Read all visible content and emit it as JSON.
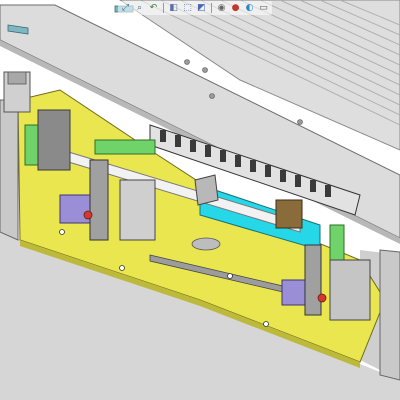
{
  "app": {
    "title": ""
  },
  "toolbar": {
    "buttons": [
      {
        "name": "zoom-to-fit-button",
        "icon": "zoom-fit-icon",
        "glyph": "⤢",
        "color": "#3a6ea5"
      },
      {
        "name": "zoom-to-area-button",
        "icon": "zoom-area-icon",
        "glyph": "⌕",
        "color": "#3a6ea5"
      },
      {
        "name": "previous-view-button",
        "icon": "previous-view-icon",
        "glyph": "↶",
        "color": "#2f7d3a"
      },
      {
        "name": "section-view-button",
        "icon": "section-view-icon",
        "glyph": "◧",
        "color": "#5b6fa8"
      },
      {
        "name": "view-orientation-button",
        "icon": "view-orientation-icon",
        "glyph": "⬚",
        "color": "#4a67b0"
      },
      {
        "name": "display-style-button",
        "icon": "display-style-icon",
        "glyph": "◩",
        "color": "#4a67b0"
      },
      {
        "name": "hide-show-items-button",
        "icon": "eye-icon",
        "glyph": "◉",
        "color": "#666666"
      },
      {
        "name": "edit-appearance-button",
        "icon": "appearance-icon",
        "glyph": "●",
        "color": "#c0392b"
      },
      {
        "name": "apply-scene-button",
        "icon": "scene-icon",
        "glyph": "◐",
        "color": "#2e86c1"
      },
      {
        "name": "view-settings-button",
        "icon": "monitor-icon",
        "glyph": "▭",
        "color": "#555555"
      }
    ]
  },
  "colors": {
    "background": "#ffffff",
    "floor": "#d9d9d9",
    "base_plate": "#e9e64f",
    "frame": "#d6d6d6",
    "frame_edge": "#707070",
    "cable_chain": "#3a3a3a",
    "cyan_block": "#26d7e8",
    "green_bracket": "#6fd36a",
    "purple_block": "#9a8fd6",
    "brown_sensor": "#8a6b3a",
    "red_accent": "#d43a2a"
  }
}
